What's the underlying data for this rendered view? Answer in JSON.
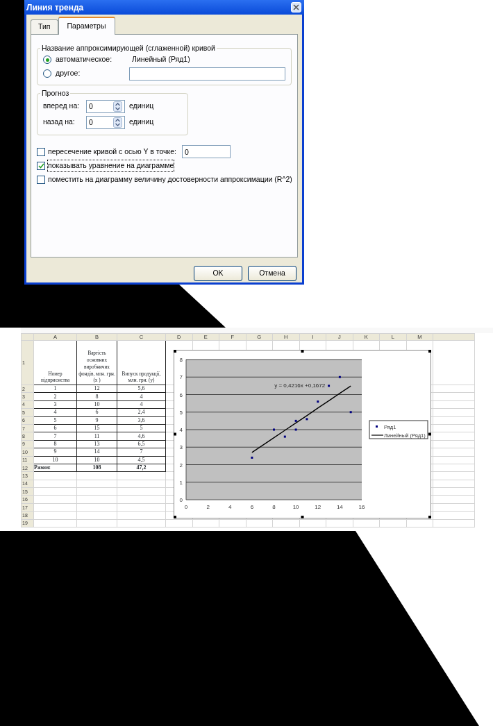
{
  "dialog": {
    "title": "Линия тренда",
    "tabs": [
      {
        "label": "Тип",
        "selected": false
      },
      {
        "label": "Параметры",
        "selected": true
      }
    ],
    "name_group": {
      "legend": "Название аппроксимирующей (сглаженной) кривой",
      "options": [
        {
          "kind": "text",
          "label": "автоматическое:",
          "selected": true,
          "value": "Линейный (Ряд1)"
        },
        {
          "kind": "field",
          "label": "другое:",
          "selected": false
        }
      ]
    },
    "forecast": {
      "legend": "Прогноз",
      "rows": [
        {
          "label": "вперед на:",
          "value": "0",
          "unit": "единиц"
        },
        {
          "label": "назад на:",
          "value": "0",
          "unit": "единиц"
        }
      ]
    },
    "options": [
      {
        "label": "пересечение кривой с осью Y в точке:",
        "checked": false,
        "focused": false,
        "value": "0"
      },
      {
        "label": "показывать уравнение на диаграмме",
        "checked": true,
        "focused": true
      },
      {
        "label": "поместить на диаграмму величину достоверности аппроксимации (R^2)",
        "checked": false,
        "focused": false
      }
    ],
    "buttons": [
      "OK",
      "Отмена"
    ]
  },
  "spreadsheet": {
    "columns": [
      "A",
      "B",
      "C",
      "D",
      "E",
      "F",
      "G",
      "H",
      "I",
      "J",
      "K",
      "L",
      "M"
    ],
    "row_numbers": [
      "1",
      "2",
      "3",
      "4",
      "5",
      "6",
      "7",
      "8",
      "9",
      "10",
      "11",
      "12",
      "13",
      "14",
      "15",
      "16",
      "17",
      "18",
      "19"
    ],
    "header_row": [
      "Номер підприємства",
      "Вартість основних виробничих фондів, млн. грн. (x )",
      "Випуск продукції, млн. грн. (y)"
    ],
    "rows": [
      [
        "1",
        "12",
        "5,6"
      ],
      [
        "2",
        "8",
        "4"
      ],
      [
        "3",
        "10",
        "4"
      ],
      [
        "4",
        "6",
        "2,4"
      ],
      [
        "5",
        "9",
        "3,6"
      ],
      [
        "6",
        "15",
        "5"
      ],
      [
        "7",
        "11",
        "4,6"
      ],
      [
        "8",
        "13",
        "6,5"
      ],
      [
        "9",
        "14",
        "7"
      ],
      [
        "10",
        "10",
        "4,5"
      ]
    ],
    "total": [
      "Разом:",
      "108",
      "47,2"
    ],
    "chart": {
      "chart_data": {
        "type": "scatter",
        "x": [
          12,
          8,
          10,
          6,
          9,
          15,
          11,
          13,
          14,
          10
        ],
        "series": [
          {
            "name": "Ряд1",
            "type": "scatter",
            "color": "#000080",
            "values": [
              5.6,
              4,
              4,
              2.4,
              3.6,
              5,
              4.6,
              6.5,
              7,
              4.5
            ]
          },
          {
            "name": "Линейный (Ряд1)",
            "type": "line",
            "color": "#000000",
            "values": [
              5.23,
              3.54,
              4.38,
              2.7,
              3.96,
              6.49,
              4.8,
              5.65,
              6.07,
              4.38
            ]
          }
        ],
        "xlim": [
          0,
          16
        ],
        "ylim": [
          0,
          8
        ],
        "xticks": [
          0,
          2,
          4,
          6,
          8,
          10,
          12,
          14,
          16
        ],
        "yticks": [
          0,
          1,
          2,
          3,
          4,
          5,
          6,
          7,
          8
        ],
        "grid": true,
        "legend": "right",
        "annotations": [
          "y = 0,4216x +0,1672"
        ]
      }
    }
  }
}
